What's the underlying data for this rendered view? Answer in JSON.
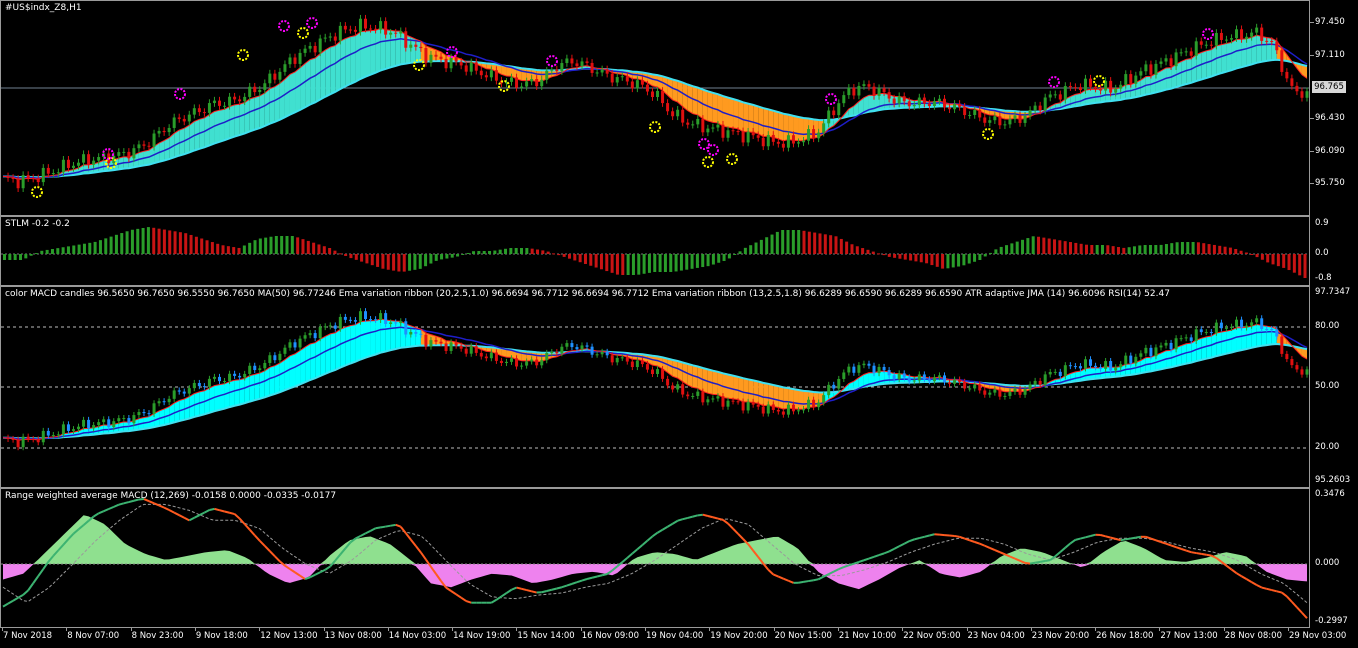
{
  "panes": {
    "main": {
      "title": "#US$indx_Z8,H1",
      "scale": [
        "97.450",
        "97.110",
        "96.430",
        "96.090",
        "95.750"
      ],
      "current_price": "96.765"
    },
    "stlm": {
      "title": "STLM -0.2 -0.2",
      "scale": [
        "0.9",
        "0.0",
        "-0.8"
      ]
    },
    "macd_candles": {
      "title": "color MACD candles 96.5650 96.7650 96.5550 96.7650 MA(50) 96.77246 Ema variation ribbon (20,2.5,1.0) 96.6694 96.7712 96.6694 96.7712 Ema variation ribbon (13,2.5,1.8) 96.6289 96.6590 96.6289 96.6590 ATR adaptive JMA (14) 96.6096 RSI(14) 52.47",
      "scale": [
        "97.7347",
        "80.00",
        "50.00",
        "20.00",
        "95.2603"
      ]
    },
    "rwa_macd": {
      "title": "Range weighted average MACD (12,269) -0.0158 0.0000 -0.0335 -0.0177",
      "scale": [
        "0.3476",
        "0.000",
        "-0.2997"
      ]
    }
  },
  "time_axis": [
    "7 Nov 2018",
    "8 Nov 07:00",
    "8 Nov 23:00",
    "9 Nov 18:00",
    "12 Nov 13:00",
    "13 Nov 08:00",
    "14 Nov 03:00",
    "14 Nov 19:00",
    "15 Nov 14:00",
    "16 Nov 09:00",
    "19 Nov 04:00",
    "19 Nov 20:00",
    "20 Nov 15:00",
    "21 Nov 10:00",
    "22 Nov 05:00",
    "23 Nov 04:00",
    "23 Nov 20:00",
    "26 Nov 18:00",
    "27 Nov 13:00",
    "28 Nov 08:00",
    "29 Nov 03:00"
  ],
  "colors": {
    "background": "#000000",
    "bull": "#2a9d2a",
    "bear": "#e01010",
    "ribbon_up": "#40e0d0",
    "ribbon_down": "#ff9a1f",
    "ma_line": "#40e0f0",
    "hist_up": "#8fe08f",
    "hist_down": "#ee82ee",
    "signal_orange": "#ff5a1f",
    "signal_green": "#3cb371",
    "fractal_yellow": "#ffff00",
    "fractal_magenta": "#ff00ff"
  },
  "price_series": [
    95.8,
    95.78,
    95.82,
    95.88,
    95.95,
    96.0,
    96.02,
    96.05,
    96.1,
    96.2,
    96.35,
    96.45,
    96.52,
    96.6,
    96.62,
    96.7,
    96.8,
    96.95,
    97.1,
    97.2,
    97.3,
    97.38,
    97.42,
    97.4,
    97.35,
    97.22,
    97.1,
    97.05,
    97.02,
    96.95,
    96.88,
    96.82,
    96.8,
    96.85,
    97.0,
    97.05,
    96.98,
    96.9,
    96.85,
    96.8,
    96.7,
    96.5,
    96.4,
    96.35,
    96.32,
    96.28,
    96.25,
    96.2,
    96.18,
    96.22,
    96.3,
    96.55,
    96.75,
    96.78,
    96.7,
    96.62,
    96.6,
    96.62,
    96.58,
    96.52,
    96.45,
    96.4,
    96.42,
    96.5,
    96.65,
    96.72,
    96.8,
    96.78,
    96.75,
    96.85,
    96.95,
    97.02,
    97.1,
    97.18,
    97.25,
    97.3,
    97.32,
    97.35,
    97.2,
    96.75,
    96.7
  ],
  "stlm_series": [
    -0.2,
    -0.2,
    0.1,
    0.2,
    0.3,
    0.4,
    0.6,
    0.8,
    0.9,
    0.8,
    0.7,
    0.5,
    0.3,
    0.2,
    0.5,
    0.6,
    0.6,
    0.4,
    0.2,
    -0.1,
    -0.3,
    -0.5,
    -0.6,
    -0.5,
    -0.2,
    -0.1,
    0.1,
    0.1,
    0.2,
    0.2,
    0.1,
    -0.1,
    -0.3,
    -0.5,
    -0.7,
    -0.7,
    -0.6,
    -0.6,
    -0.5,
    -0.4,
    -0.2,
    0.2,
    0.5,
    0.8,
    0.8,
    0.7,
    0.6,
    0.3,
    0.1,
    -0.1,
    -0.2,
    -0.3,
    -0.5,
    -0.4,
    -0.2,
    0.2,
    0.4,
    0.6,
    0.5,
    0.4,
    0.3,
    0.3,
    0.2,
    0.3,
    0.3,
    0.4,
    0.4,
    0.3,
    0.2,
    0.0,
    -0.3,
    -0.5,
    -0.8
  ],
  "hist_series": [
    -0.08,
    -0.05,
    0.05,
    0.15,
    0.25,
    0.2,
    0.1,
    0.05,
    0.02,
    0.04,
    0.06,
    0.07,
    0.03,
    -0.05,
    -0.1,
    -0.07,
    0.04,
    0.12,
    0.14,
    0.1,
    0.02,
    -0.1,
    -0.12,
    -0.08,
    -0.05,
    -0.06,
    -0.1,
    -0.08,
    -0.05,
    -0.04,
    -0.06,
    0.03,
    0.06,
    0.05,
    0.02,
    0.06,
    0.1,
    0.12,
    0.14,
    0.08,
    -0.04,
    -0.1,
    -0.13,
    -0.08,
    -0.02,
    0.02,
    -0.05,
    -0.07,
    -0.04,
    0.04,
    0.08,
    0.06,
    0.02,
    -0.02,
    0.06,
    0.12,
    0.08,
    0.02,
    0.01,
    0.03,
    0.06,
    0.04,
    -0.04,
    -0.08,
    -0.09
  ],
  "macd_line": [
    -0.22,
    -0.15,
    0.02,
    0.15,
    0.25,
    0.3,
    0.33,
    0.28,
    0.22,
    0.28,
    0.25,
    0.12,
    0.0,
    -0.08,
    -0.02,
    0.12,
    0.18,
    0.2,
    0.05,
    -0.12,
    -0.2,
    -0.2,
    -0.12,
    -0.15,
    -0.12,
    -0.08,
    -0.05,
    0.05,
    0.15,
    0.22,
    0.25,
    0.22,
    0.1,
    -0.05,
    -0.1,
    -0.08,
    -0.02,
    0.02,
    0.06,
    0.12,
    0.15,
    0.14,
    0.1,
    0.05,
    0.0,
    0.02,
    0.12,
    0.15,
    0.12,
    0.14,
    0.1,
    0.06,
    0.04,
    -0.05,
    -0.12,
    -0.15,
    -0.28
  ],
  "signal_line": [
    -0.12,
    -0.2,
    -0.12,
    0.0,
    0.12,
    0.22,
    0.3,
    0.3,
    0.27,
    0.22,
    0.22,
    0.18,
    0.08,
    0.0,
    -0.05,
    0.02,
    0.12,
    0.17,
    0.14,
    0.02,
    -0.1,
    -0.17,
    -0.18,
    -0.16,
    -0.15,
    -0.12,
    -0.1,
    -0.05,
    0.02,
    0.1,
    0.18,
    0.23,
    0.2,
    0.1,
    0.0,
    -0.06,
    -0.06,
    -0.03,
    0.01,
    0.06,
    0.1,
    0.13,
    0.13,
    0.1,
    0.05,
    0.02,
    0.06,
    0.11,
    0.13,
    0.13,
    0.11,
    0.08,
    0.06,
    0.02,
    -0.05,
    -0.1,
    -0.2
  ]
}
